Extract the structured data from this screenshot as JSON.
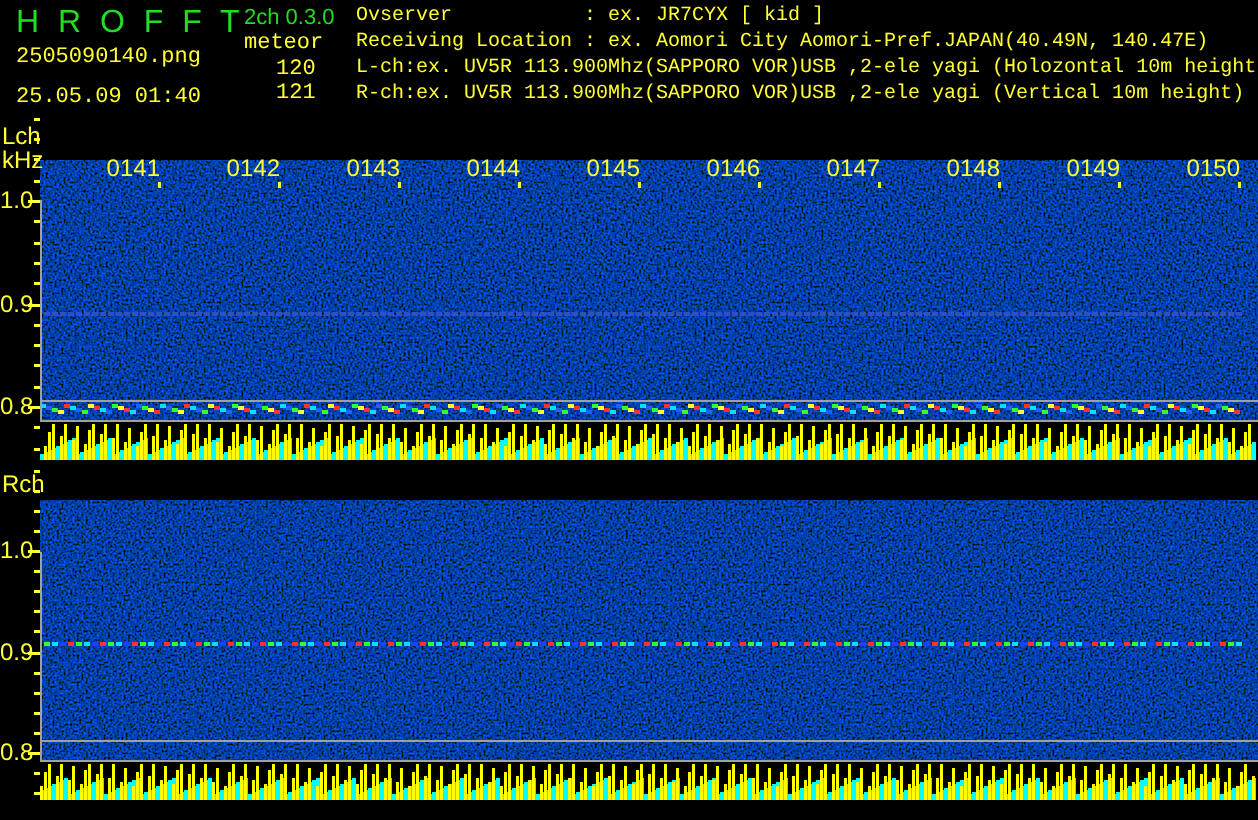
{
  "title": "H R O F F T",
  "version": "2ch 0.3.0",
  "file_name": "2505090140.png",
  "mode": "meteor",
  "date_time": "25.05.09 01:40",
  "counts": [
    "120",
    "121"
  ],
  "info_lines": [
    "Ovserver           : ex. JR7CYX [ kid ]",
    "Receiving Location : ex. Aomori City Aomori-Pref.JAPAN(40.49N, 140.47E)",
    "L-ch:ex. UV5R 113.900Mhz(SAPPORO VOR)USB ,2-ele yagi (Holozontal 10m height",
    "R-ch:ex. UV5R 113.900Mhz(SAPPORO VOR)USB ,2-ele yagi (Vertical 10m height)"
  ],
  "time_labels": [
    "0141",
    "0142",
    "0143",
    "0144",
    "0145",
    "0146",
    "0147",
    "0148",
    "0149",
    "0150"
  ],
  "panels": [
    {
      "channel": "Lch",
      "unit": "kHz",
      "y_labels": [
        "1.0",
        "0.9",
        "0.8"
      ]
    },
    {
      "channel": "Rch",
      "y_labels": [
        "1.0",
        "0.9",
        "0.8"
      ]
    }
  ]
}
